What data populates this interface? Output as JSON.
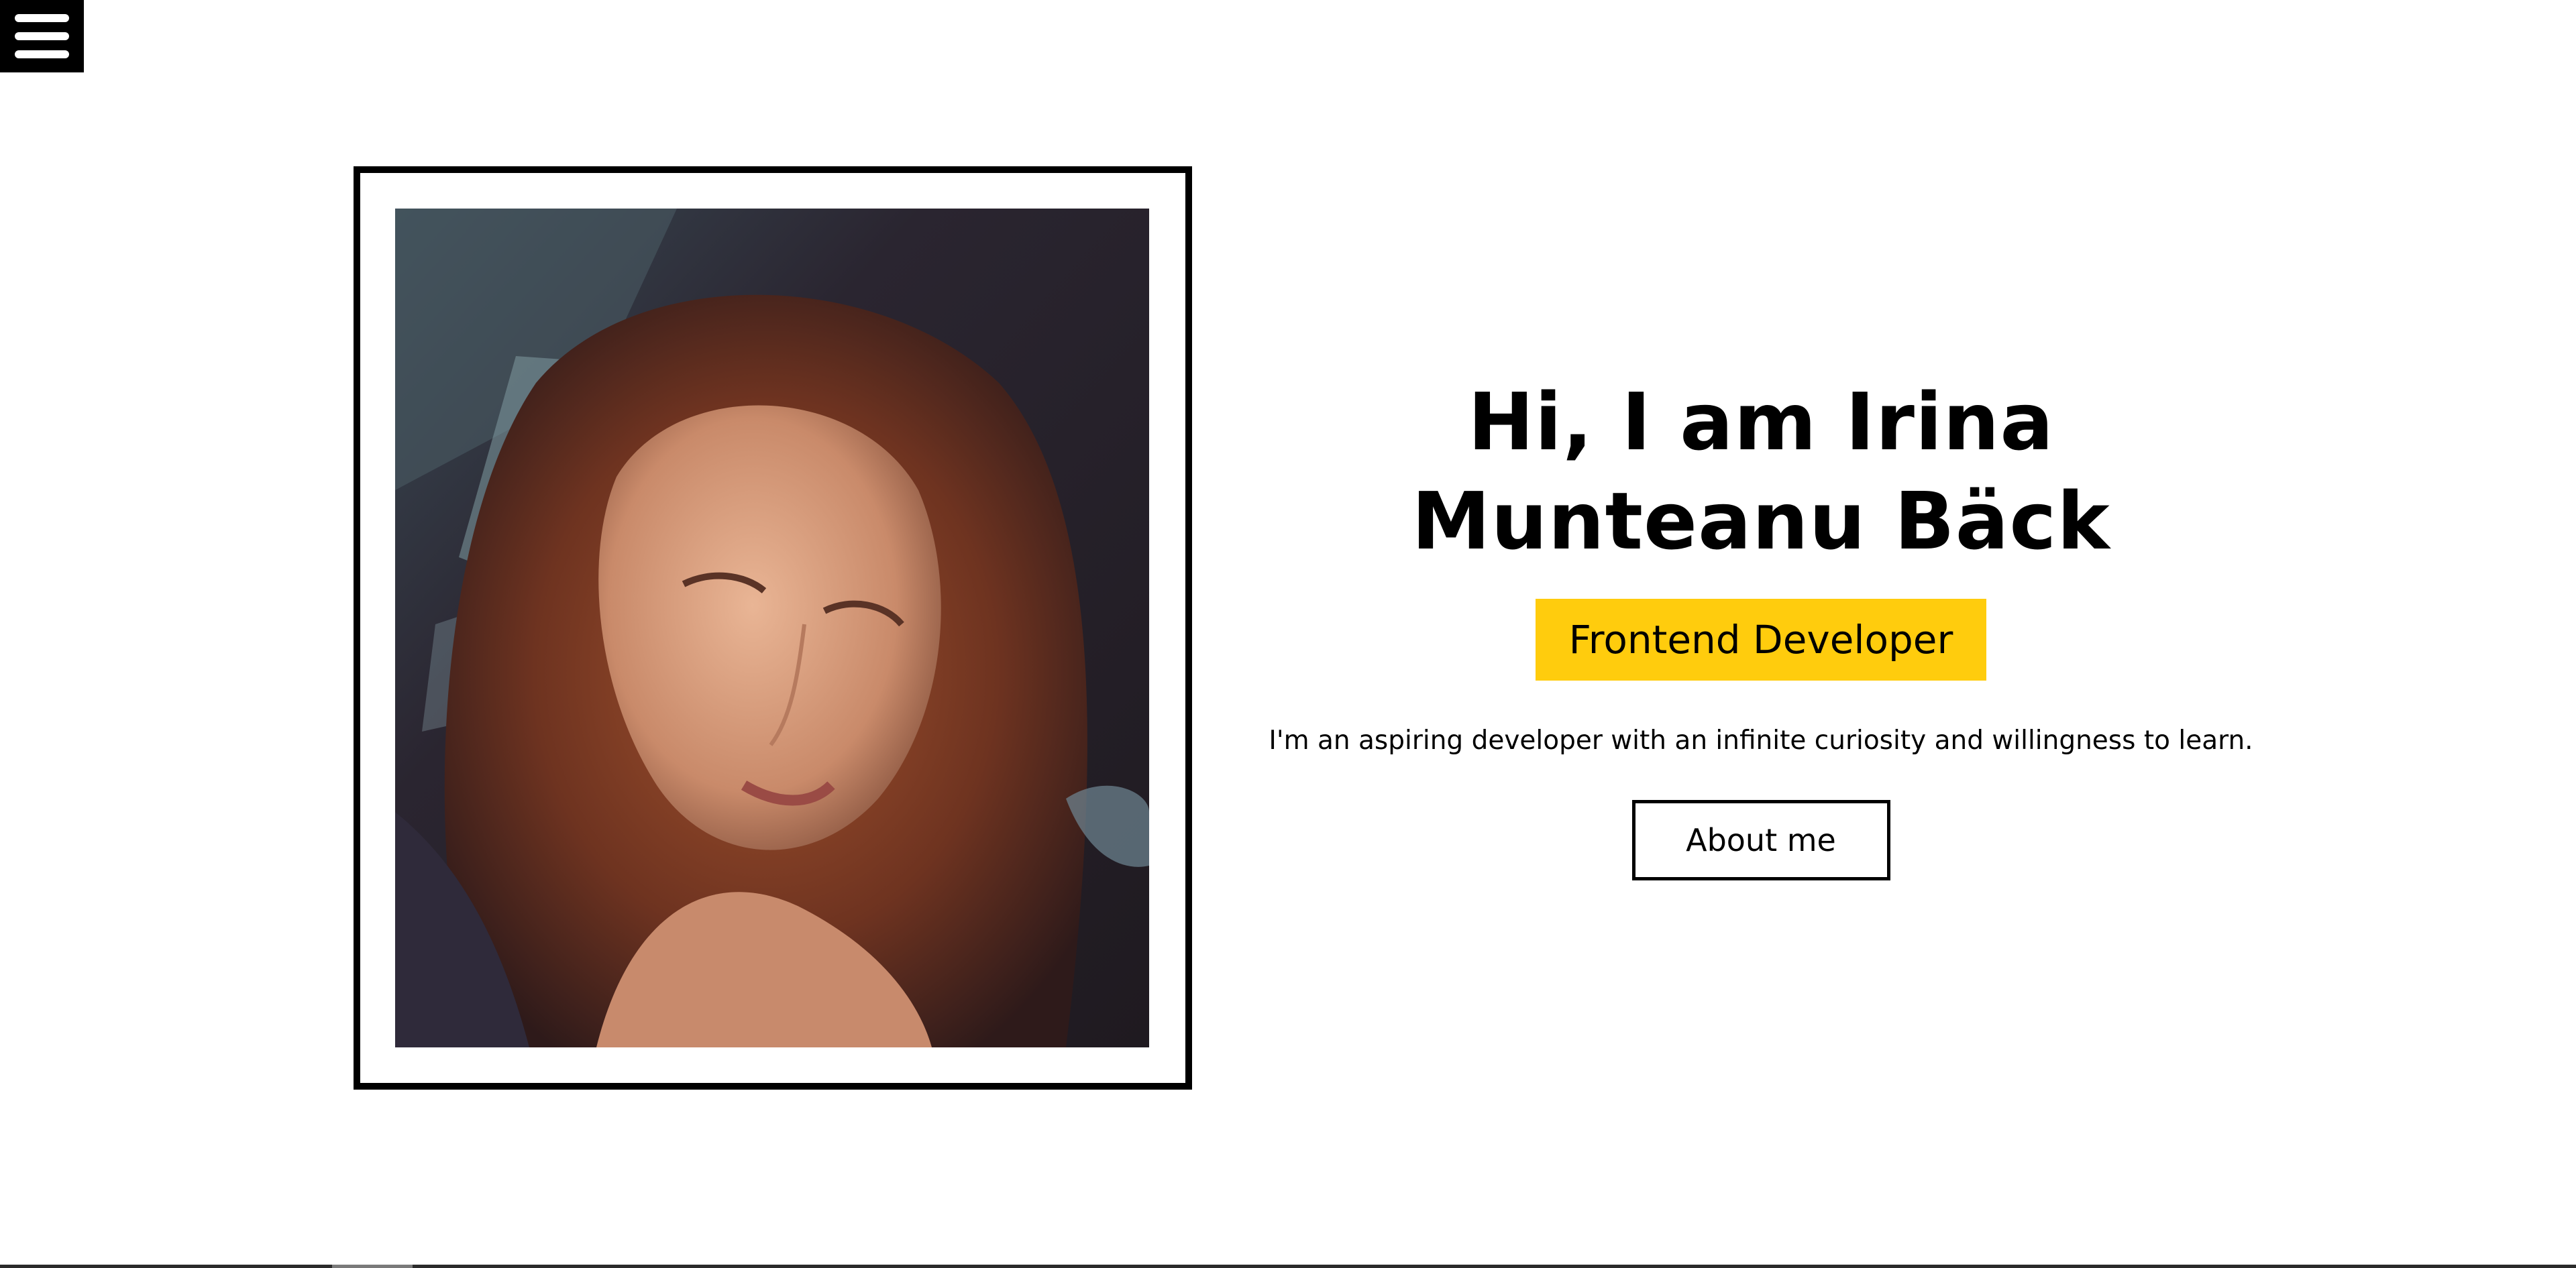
{
  "menu": {
    "icon": "hamburger-menu-icon"
  },
  "hero": {
    "photo_icon": "portrait-photo",
    "title": "Hi, I am Irina Munteanu Bäck",
    "role": "Frontend Developer",
    "tagline": "I'm an aspiring developer with an infinite curiosity and willingness to learn.",
    "about_button_label": "About me"
  },
  "colors": {
    "accent": "#ffcc0d",
    "text": "#000000",
    "background": "#ffffff"
  }
}
